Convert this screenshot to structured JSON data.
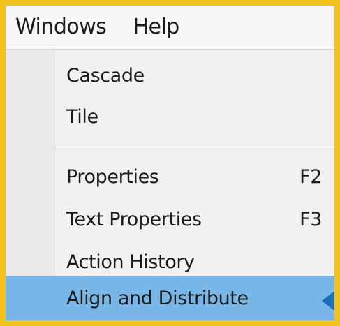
{
  "menubar": {
    "items": [
      {
        "label": "Windows"
      },
      {
        "label": "Help"
      }
    ]
  },
  "menu": {
    "items": [
      {
        "label": "Cascade",
        "shortcut": ""
      },
      {
        "label": "Tile",
        "shortcut": ""
      },
      {
        "label": "Properties",
        "shortcut": "F2"
      },
      {
        "label": "Text Properties",
        "shortcut": "F3"
      },
      {
        "label": "Action History",
        "shortcut": ""
      },
      {
        "label": "Align and Distribute",
        "shortcut": "",
        "highlighted": true
      }
    ]
  },
  "colors": {
    "border": "#f3c21d",
    "highlight": "#77b6e6",
    "submenu_arrow": "#1b6fb8"
  },
  "icons": {
    "submenu": "triangle-left-icon"
  }
}
